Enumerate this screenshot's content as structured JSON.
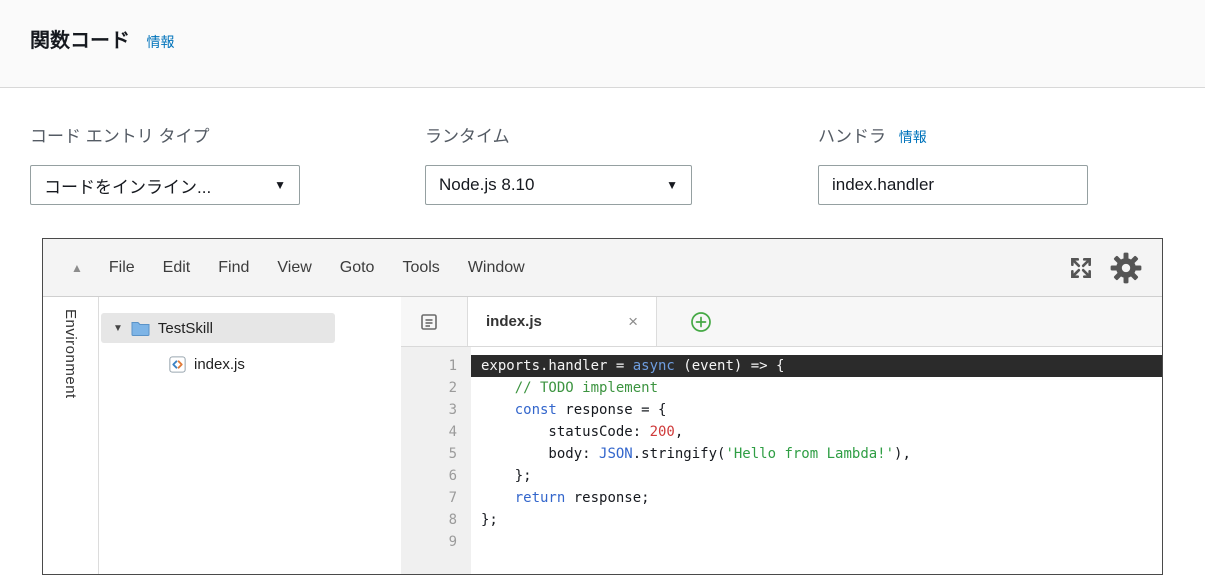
{
  "header": {
    "title": "関数コード",
    "info_link": "情報"
  },
  "fields": {
    "code_entry": {
      "label": "コード エントリ タイプ",
      "value": "コードをインライン..."
    },
    "runtime": {
      "label": "ランタイム",
      "value": "Node.js 8.10"
    },
    "handler": {
      "label": "ハンドラ",
      "info_link": "情報",
      "value": "index.handler"
    }
  },
  "editor": {
    "menu": [
      "File",
      "Edit",
      "Find",
      "View",
      "Goto",
      "Tools",
      "Window"
    ],
    "sidebar_label": "Environment",
    "tree": {
      "folder_name": "TestSkill",
      "file_name": "index.js"
    },
    "tab": {
      "label": "index.js"
    },
    "code": {
      "lines": [
        {
          "active": true,
          "tokens": [
            {
              "t": "exports.handler = ",
              "y": "w"
            },
            {
              "t": "async",
              "y": "k"
            },
            {
              "t": " (event) => {",
              "y": "w"
            }
          ]
        },
        {
          "active": false,
          "tokens": [
            {
              "t": "    ",
              "y": "p"
            },
            {
              "t": "// TODO implement",
              "y": "c"
            }
          ]
        },
        {
          "active": false,
          "tokens": [
            {
              "t": "    ",
              "y": "p"
            },
            {
              "t": "const",
              "y": "k"
            },
            {
              "t": " response = {",
              "y": "p"
            }
          ]
        },
        {
          "active": false,
          "tokens": [
            {
              "t": "        statusCode: ",
              "y": "p"
            },
            {
              "t": "200",
              "y": "n"
            },
            {
              "t": ",",
              "y": "p"
            }
          ]
        },
        {
          "active": false,
          "tokens": [
            {
              "t": "        body: ",
              "y": "p"
            },
            {
              "t": "JSON",
              "y": "k"
            },
            {
              "t": ".stringify(",
              "y": "p"
            },
            {
              "t": "'Hello from Lambda!'",
              "y": "s"
            },
            {
              "t": "),",
              "y": "p"
            }
          ]
        },
        {
          "active": false,
          "tokens": [
            {
              "t": "    };",
              "y": "p"
            }
          ]
        },
        {
          "active": false,
          "tokens": [
            {
              "t": "    ",
              "y": "p"
            },
            {
              "t": "return",
              "y": "k"
            },
            {
              "t": " response;",
              "y": "p"
            }
          ]
        },
        {
          "active": false,
          "tokens": [
            {
              "t": "};",
              "y": "p"
            }
          ]
        },
        {
          "active": false,
          "tokens": []
        }
      ]
    }
  },
  "icons": {
    "collapse": "▲",
    "dropdown_arrow": "▼",
    "tree_expanded": "▼",
    "tab_close": "×"
  },
  "colors": {
    "link": "#0073bb",
    "keyword": "#3366cc",
    "comment": "#3c9440",
    "string": "#2f9e44",
    "number": "#cf3a3a",
    "active_line_bg": "#2b2b2b"
  }
}
